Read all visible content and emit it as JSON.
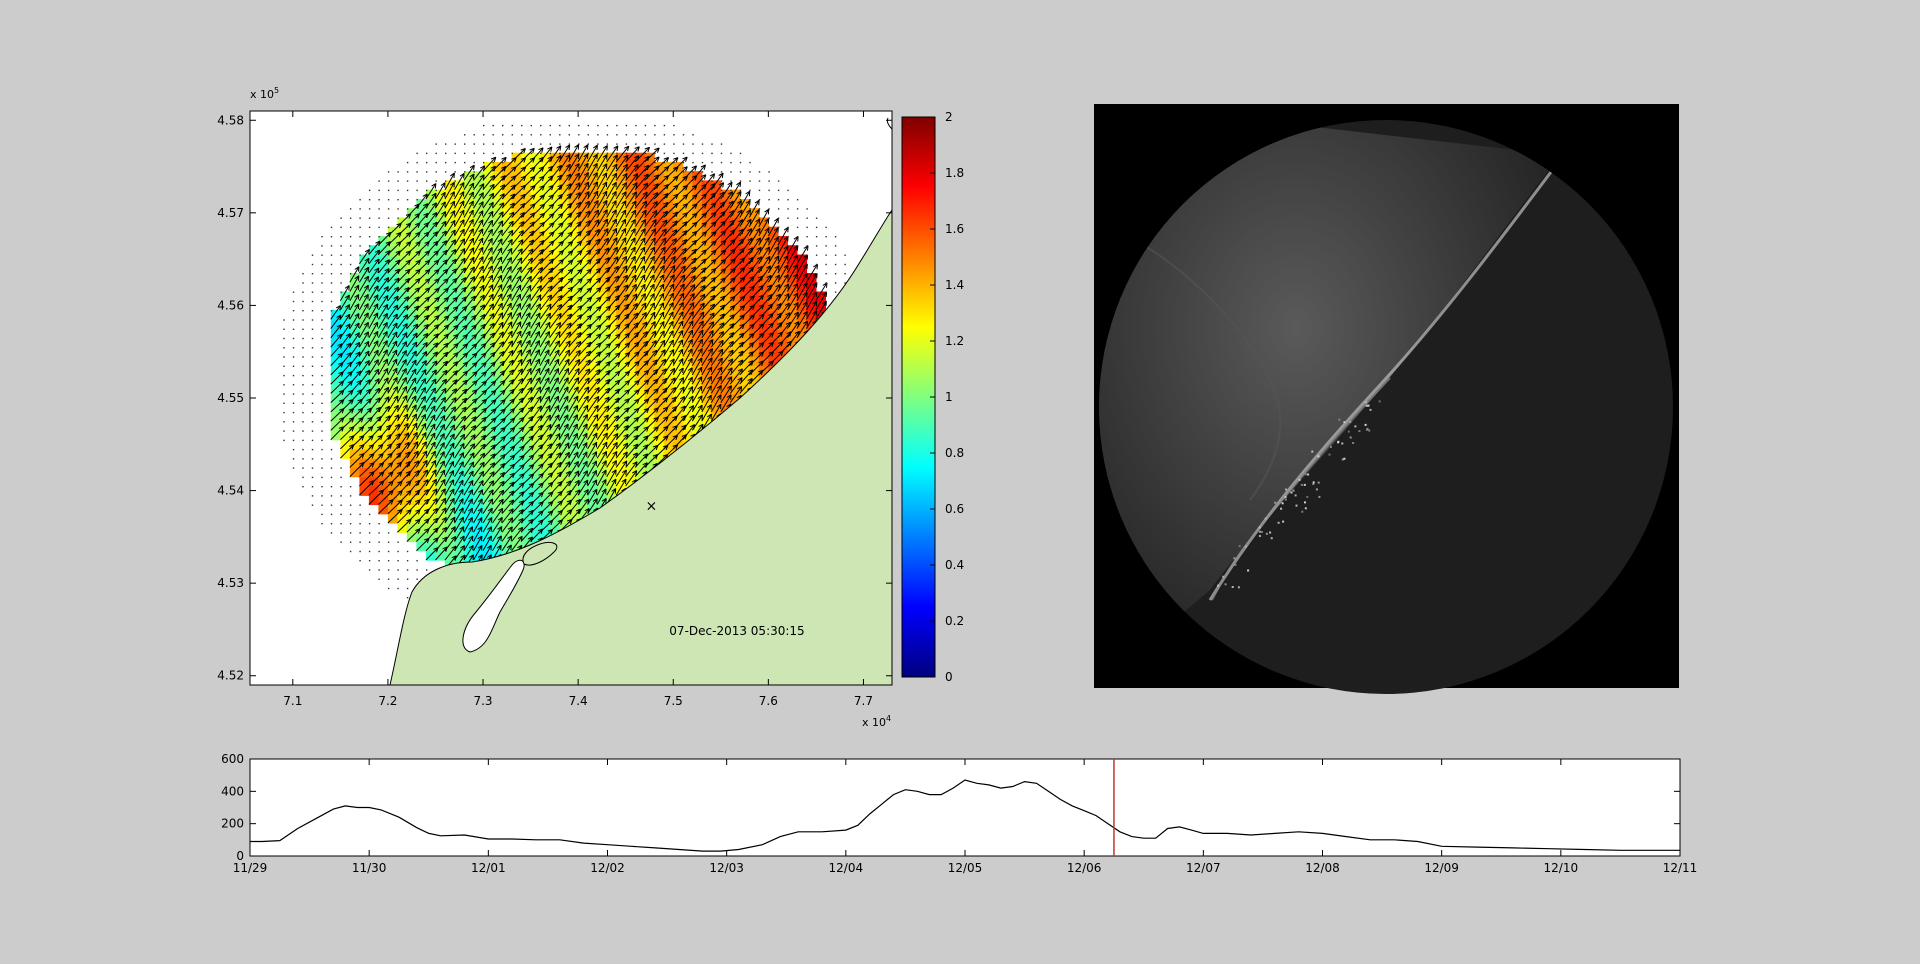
{
  "figure_background": "#cccccc",
  "chart_data": [
    {
      "type": "heatmap",
      "subtype": "current-velocity-map-with-vectors",
      "title": "",
      "xlabel": "",
      "ylabel": "",
      "xlim": [
        70.55,
        77.3
      ],
      "ylim": [
        451.9,
        458.1
      ],
      "x_ticks": [
        "7.1",
        "7.2",
        "7.3",
        "7.4",
        "7.5",
        "7.6",
        "7.7"
      ],
      "y_ticks": [
        "4.52",
        "4.53",
        "4.54",
        "4.55",
        "4.56",
        "4.57",
        "4.58"
      ],
      "x_exponent_label": "x 10",
      "x_exponent": "4",
      "y_exponent_label": "x 10",
      "y_exponent": "5",
      "timestamp": "07-Dec-2013 05:30:15",
      "marker": {
        "symbol": "×",
        "x": 74.77,
        "y": 453.83,
        "color": "#e03020"
      },
      "land_color": "#cde6b4",
      "colorbar": {
        "min": 0,
        "max": 2,
        "ticks": [
          "0",
          "0.2",
          "0.4",
          "0.6",
          "0.8",
          "1",
          "1.2",
          "1.4",
          "1.6",
          "1.8",
          "2"
        ],
        "colormap": "jet"
      }
    },
    {
      "type": "other",
      "subtype": "radar-image",
      "background": "#000000",
      "shape": "circle"
    },
    {
      "type": "line",
      "title": "",
      "xlabel": "",
      "ylabel": "",
      "ylim": [
        0,
        600
      ],
      "y_ticks": [
        "0",
        "200",
        "400",
        "600"
      ],
      "x_ticks": [
        "11/29",
        "11/30",
        "12/01",
        "12/02",
        "12/03",
        "12/04",
        "12/05",
        "12/06",
        "12/07",
        "12/08",
        "12/09",
        "12/10",
        "12/11"
      ],
      "series": [
        {
          "color": "#000000",
          "x": [
            0,
            0.1,
            0.25,
            0.4,
            0.55,
            0.7,
            0.8,
            0.9,
            1.0,
            1.1,
            1.25,
            1.4,
            1.5,
            1.6,
            1.8,
            2.0,
            2.2,
            2.4,
            2.6,
            2.8,
            3.0,
            3.2,
            3.4,
            3.6,
            3.8,
            3.95,
            4.1,
            4.3,
            4.45,
            4.6,
            4.8,
            5.0,
            5.1,
            5.2,
            5.3,
            5.4,
            5.5,
            5.6,
            5.7,
            5.8,
            5.9,
            6.0,
            6.1,
            6.2,
            6.3,
            6.4,
            6.5,
            6.6,
            6.7,
            6.8,
            6.9,
            7.0,
            7.1,
            7.2,
            7.3,
            7.4,
            7.5,
            7.6,
            7.7,
            7.8,
            7.9,
            8.0,
            8.2,
            8.4,
            8.6,
            8.8,
            9.0,
            9.2,
            9.4,
            9.6,
            9.8,
            10.0,
            10.3,
            10.6,
            10.9,
            11.2,
            11.5,
            11.8,
            12.0
          ],
          "y": [
            90,
            90,
            95,
            170,
            230,
            290,
            310,
            300,
            300,
            285,
            240,
            175,
            140,
            125,
            130,
            105,
            105,
            100,
            100,
            80,
            70,
            60,
            50,
            40,
            30,
            30,
            40,
            70,
            120,
            150,
            150,
            160,
            190,
            260,
            320,
            380,
            410,
            400,
            380,
            380,
            420,
            470,
            450,
            440,
            420,
            430,
            460,
            450,
            400,
            350,
            310,
            280,
            250,
            200,
            150,
            120,
            110,
            110,
            170,
            180,
            160,
            140,
            140,
            130,
            140,
            150,
            140,
            120,
            100,
            100,
            90,
            60,
            55,
            50,
            45,
            40,
            35,
            35,
            35
          ]
        }
      ],
      "current_time_marker": {
        "x": 7.25,
        "color": "#c0392b"
      }
    }
  ]
}
